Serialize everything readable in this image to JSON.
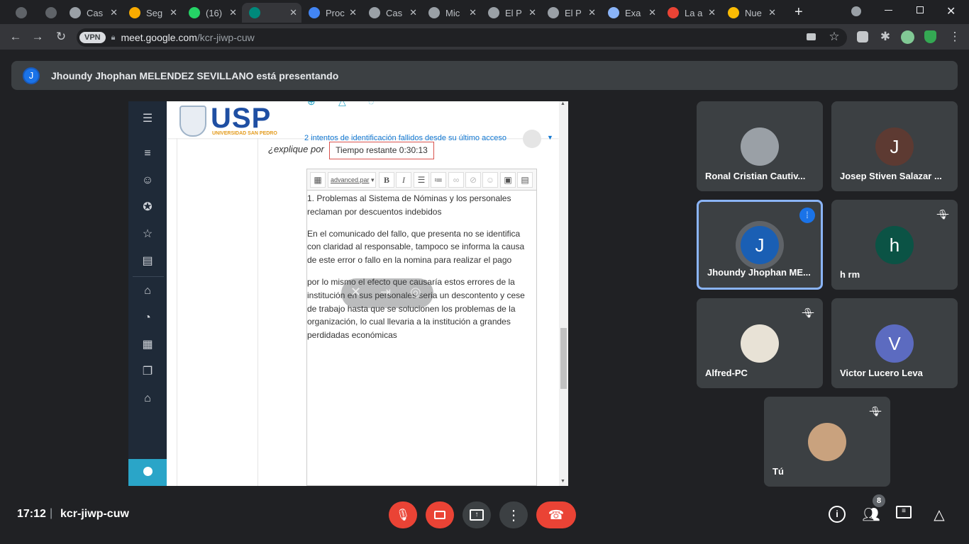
{
  "tabs": [
    {
      "label": "",
      "color": "#5f6368"
    },
    {
      "label": "",
      "color": "#5f6368"
    },
    {
      "label": "Cas",
      "color": "#9aa0a6"
    },
    {
      "label": "Seg",
      "color": "#f9ab00"
    },
    {
      "label": "(16)",
      "color": "#25d366"
    },
    {
      "label": "",
      "color": "#00897b",
      "active": true
    },
    {
      "label": "Proc",
      "color": "#4285f4"
    },
    {
      "label": "Cas",
      "color": "#9aa0a6"
    },
    {
      "label": "Mic",
      "color": "#9aa0a6"
    },
    {
      "label": "El P",
      "color": "#9aa0a6"
    },
    {
      "label": "El P",
      "color": "#9aa0a6"
    },
    {
      "label": "Exa",
      "color": "#8ab4f8"
    },
    {
      "label": "La a",
      "color": "#ea4335"
    },
    {
      "label": "Nue",
      "color": "#fbbc04"
    }
  ],
  "browser": {
    "vpn_label": "VPN",
    "url_host": "meet.google.com",
    "url_path": "/kcr-jiwp-cuw"
  },
  "banner": {
    "avatar_initial": "J",
    "text": "Jhoundy Jhophan MELENDEZ SEVILLANO está presentando"
  },
  "presentation": {
    "logo_text": "USP",
    "logo_subtext": "UNIVERSIDAD SAN PEDRO",
    "login_notice": "2 intentos de identificación fallidos desde su último acceso",
    "question_fragment": "¿explique por",
    "timer": "Tiempo restante 0:30:13",
    "editor_format": "advanced.par",
    "editor_paragraphs": [
      "1. Problemas al Sistema de Nóminas y los personales reclaman por descuentos indebidos",
      "En el comunicado del fallo, que presenta no se identifica con claridad al responsable, tampoco se informa la causa de este error o fallo  en la nomina para realizar el pago",
      "por lo mismo el efecto que causaría estos errores de la institución en sus personales seria un descontento y  cese de trabajo hasta que se solucionen los problemas de la organización, lo cual llevaria a la institución a grandes perdidadas económicas"
    ]
  },
  "participants": [
    {
      "name": "Ronal Cristian Cautiv...",
      "initial": "",
      "color": "#9aa0a6",
      "muted": false,
      "speaking": false
    },
    {
      "name": "Josep Stiven Salazar ...",
      "initial": "J",
      "color": "#5d3a32",
      "muted": false,
      "speaking": false
    },
    {
      "name": "Jhoundy Jhophan ME...",
      "initial": "J",
      "color": "#1a5fb4",
      "muted": false,
      "speaking": true
    },
    {
      "name": "h rm",
      "initial": "h",
      "color": "#0b5345",
      "muted": true,
      "speaking": false
    },
    {
      "name": "Alfred-PC",
      "initial": "",
      "color": "#e8e2d6",
      "muted": true,
      "speaking": false
    },
    {
      "name": "Victor Lucero Leva",
      "initial": "V",
      "color": "#5c6bc0",
      "muted": false,
      "speaking": false
    },
    {
      "name": "Tú",
      "initial": "",
      "color": "#c9a27e",
      "muted": true,
      "speaking": false
    }
  ],
  "bottom": {
    "time": "17:12",
    "separator": "|",
    "meeting_code": "kcr-jiwp-cuw",
    "participant_count": "8"
  },
  "colors": {
    "end_call": "#ea4335",
    "mic_off": "#ea4335",
    "accent": "#8ab4f8",
    "speaking_border": "#8ab4f8"
  }
}
